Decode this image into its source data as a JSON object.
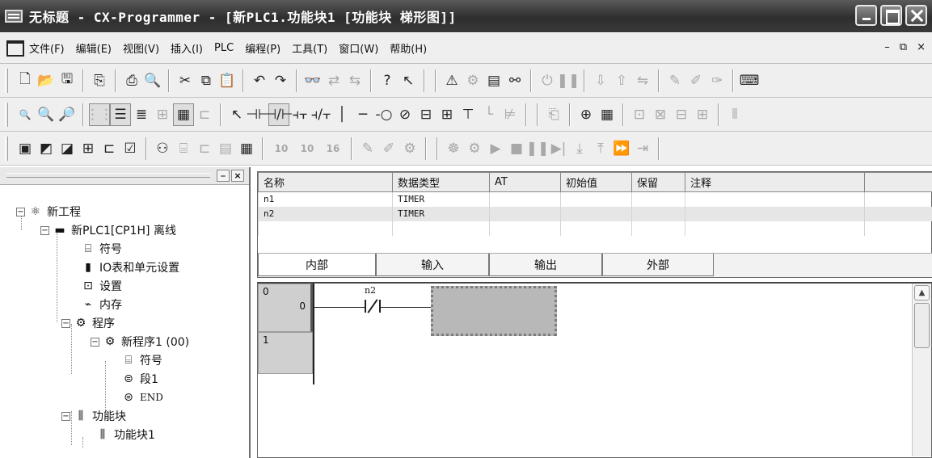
{
  "window": {
    "title": "无标题 - CX-Programmer - [新PLC1.功能块1 [功能块 梯形图]]"
  },
  "menu": {
    "items": [
      "文件(F)",
      "编辑(E)",
      "视图(V)",
      "插入(I)",
      "PLC",
      "编程(P)",
      "工具(T)",
      "窗口(W)",
      "帮助(H)"
    ],
    "mdi_controls": [
      "–",
      "⧉",
      "×"
    ]
  },
  "toolbar1": {
    "buttons": [
      "new-file-icon",
      "open-file-icon",
      "save-icon",
      "compare-icon",
      "print-icon",
      "print-preview-icon",
      "cut-icon",
      "copy-icon",
      "paste-icon",
      "undo-icon",
      "redo-icon",
      "find-icon",
      "replace-icon",
      "find-replace-icon",
      "help-icon",
      "context-help-icon",
      "warning-icon",
      "online-icon",
      "monitor-icon",
      "binoculars-icon",
      "pause-icon",
      "transfer-icon",
      "upload-icon",
      "compare-plc-icon",
      "run-icon"
    ]
  },
  "toolbar2": {
    "buttons": [
      "zoom-small-icon",
      "zoom-in-icon",
      "zoom-out-icon",
      "grid-icon",
      "show-comments-icon",
      "list-icon",
      "rung-icon",
      "bar-icon",
      "fb-icon",
      "select-icon",
      "contact-no-icon",
      "contact-nc-icon",
      "contact-or-icon",
      "contact-or-nc-icon",
      "vertical-line-icon",
      "horizontal-line-icon",
      "coil-icon",
      "coil-nc-icon",
      "instruction-icon",
      "fb-call-icon",
      "bit-icon",
      "corner-icon",
      "delete-line-icon"
    ]
  },
  "toolbar3": {
    "buttons": [
      "project-window-icon",
      "output-window-icon",
      "watch-window-icon",
      "address-window-icon",
      "io-comment-icon",
      "properties-icon",
      "cross-ref-icon",
      "symbol-icon",
      "network-icon",
      "memory-icon",
      "io-table-icon",
      "label-10-icon",
      "label-10b-icon",
      "label-16-icon",
      "online-edit-icon",
      "edit-icon",
      "diff-icon",
      "stop-icon",
      "step-icon",
      "play-icon",
      "stop-square-icon",
      "pause-icon",
      "step-over-icon",
      "step-into-icon",
      "step-out-icon",
      "fast-forward-icon",
      "end-icon"
    ],
    "labels": [
      "10",
      "10",
      "16"
    ]
  },
  "tree": {
    "nodes": [
      {
        "label": "新工程",
        "icon": "project-icon",
        "expander": "−"
      },
      {
        "label": "新PLC1[CP1H] 离线",
        "icon": "plc-icon",
        "expander": "−"
      },
      {
        "label": "符号",
        "icon": "symbol-icon"
      },
      {
        "label": "IO表和单元设置",
        "icon": "io-table-icon"
      },
      {
        "label": "设置",
        "icon": "settings-icon"
      },
      {
        "label": "内存",
        "icon": "memory-icon"
      },
      {
        "label": "程序",
        "icon": "programs-icon",
        "expander": "−"
      },
      {
        "label": "新程序1 (00)",
        "icon": "program-icon",
        "expander": "−"
      },
      {
        "label": "符号",
        "icon": "symbol-icon"
      },
      {
        "label": "段1",
        "icon": "section-icon"
      },
      {
        "label": "END",
        "icon": "end-section-icon"
      },
      {
        "label": "功能块",
        "icon": "function-blocks-icon",
        "expander": "−"
      },
      {
        "label": "功能块1",
        "icon": "function-block-icon"
      }
    ]
  },
  "variables": {
    "columns": [
      "名称",
      "数据类型",
      "AT",
      "初始值",
      "保留",
      "注释"
    ],
    "rows": [
      {
        "name": "n1",
        "type": "TIMER",
        "at": "",
        "initial": "",
        "retain": "",
        "comment": ""
      },
      {
        "name": "n2",
        "type": "TIMER",
        "at": "",
        "initial": "",
        "retain": "",
        "comment": ""
      }
    ],
    "tabs": [
      "内部",
      "输入",
      "输出",
      "外部"
    ],
    "active_tab": "内部"
  },
  "ladder": {
    "rungs": [
      {
        "number": "0",
        "step": "0"
      },
      {
        "number": "1",
        "step": ""
      }
    ],
    "contact_operand": "n2",
    "contact_type": "normally-closed"
  }
}
